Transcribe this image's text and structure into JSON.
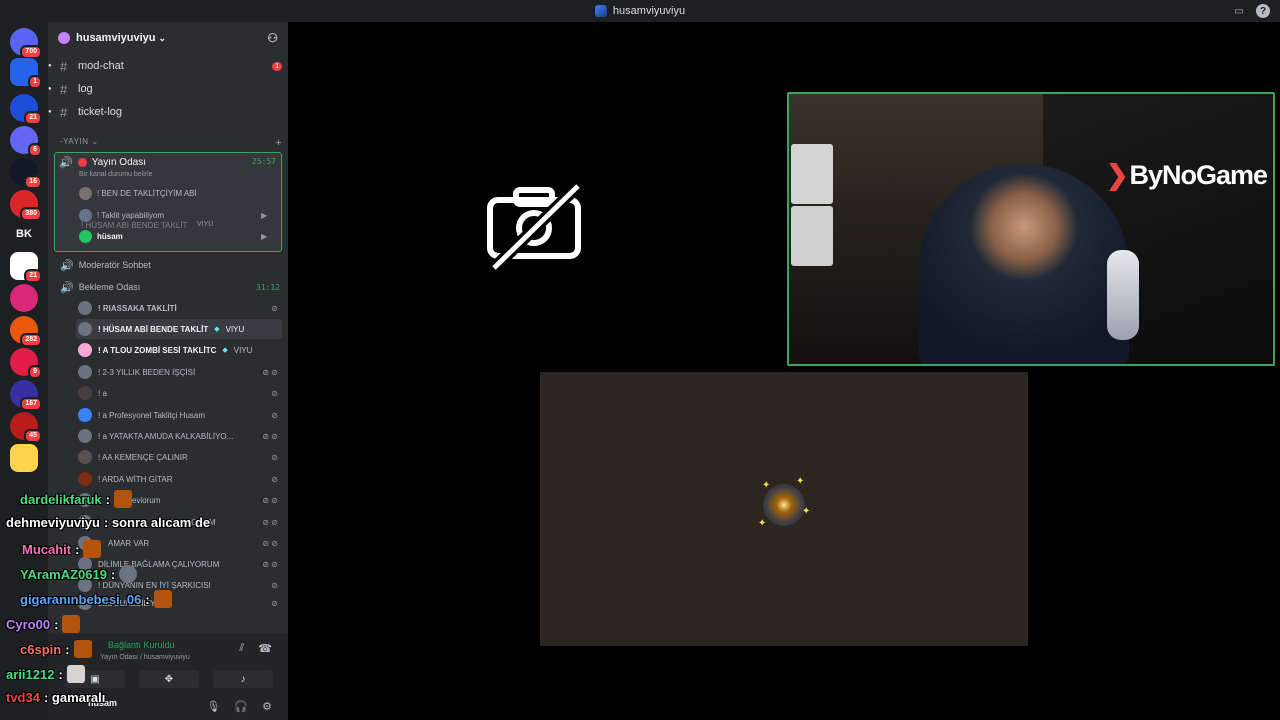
{
  "window": {
    "title": "husamviyuviyu"
  },
  "guilds": [
    {
      "id": "home",
      "badge": "700"
    },
    {
      "id": "g1",
      "badge": "1"
    },
    {
      "id": "g2",
      "badge": "21"
    },
    {
      "id": "g3",
      "badge": "6"
    },
    {
      "id": "g4",
      "badge": "16"
    },
    {
      "id": "g5",
      "badge": "380"
    },
    {
      "id": "g6",
      "text": "BK"
    },
    {
      "id": "g7",
      "badge": "21"
    },
    {
      "id": "g8",
      "badge": ""
    },
    {
      "id": "g9",
      "badge": "282"
    },
    {
      "id": "g10",
      "badge": "9"
    },
    {
      "id": "g11",
      "badge": "167"
    },
    {
      "id": "g12",
      "badge": "45"
    },
    {
      "id": "g13",
      "badge": ""
    }
  ],
  "server": {
    "name": "husamviyuviyu"
  },
  "text_channels": [
    {
      "name": "mod-chat",
      "mention": "1"
    },
    {
      "name": "log"
    },
    {
      "name": "ticket-log"
    }
  ],
  "category": {
    "name": "-YAYIN"
  },
  "active_voice": {
    "name": "Yayın Odası",
    "timer": "25:57",
    "status": "Bir kanal durumu belirle",
    "users": [
      {
        "name": "! BEN DE TAKLİTÇİYİM ABİ"
      },
      {
        "name": "! Taklit yapabiliyom"
      },
      {
        "name": "hüsam",
        "drag_text": "! HÜSAM ABİ BENDE TAKLİT",
        "tag": "VIYU"
      }
    ]
  },
  "voice_channels": [
    {
      "name": "Moderatör Sohbet"
    },
    {
      "name": "Bekleme Odası",
      "timer": "31:12"
    }
  ],
  "waiting_users": [
    {
      "name": "! RIASSAKA TAKLİTİ"
    },
    {
      "name": "! HÜSAM ABİ BENDE TAKLİT",
      "tag": "VIYU"
    },
    {
      "name": "! A TLOU ZOMBİ SESİ TAKLİTC",
      "tag": "VIYU"
    },
    {
      "name": "! 2-3 YILLIK BEDEN İŞÇİSİ"
    },
    {
      "name": "! a"
    },
    {
      "name": "! a Profesyonel Taklitçi Husam"
    },
    {
      "name": "! a YATAKTA AMUDA KALKABİLİYO..."
    },
    {
      "name": "! AA KEMENÇE ÇALINIR"
    },
    {
      "name": "! ARDA WİTH GİTAR"
    },
    {
      "name": "seviorum"
    },
    {
      "name": "ÇALIYORUM"
    },
    {
      "name": "AMAR VAR"
    },
    {
      "name": "DİLİMLE BAĞLAMA ÇALIYORUM"
    },
    {
      "name": "! DÜNYANIN EN İYİ ŞARKICISI"
    },
    {
      "name": "LEL BUKEBİLİY"
    }
  ],
  "user_panel": {
    "connection": "Bağlantı Kuruldu",
    "channel": "Yayın Odası / husamviyuviyu",
    "username": "hüsam"
  },
  "chat": [
    {
      "user": "dardelikfaruk",
      "color": "#4ade80",
      "msg": ":"
    },
    {
      "user": "dehmeviyuviyu",
      "color": "#ffffff",
      "msg": ": sonra alıcam de"
    },
    {
      "user": "Mucahit",
      "color": "#f472b6",
      "msg": ":"
    },
    {
      "user": "YAramAZ0619",
      "color": "#4ade80",
      "msg": ":"
    },
    {
      "user": "gigaranınbebesi_06",
      "color": "#60a5fa",
      "msg": ":"
    },
    {
      "user": "Cyro00",
      "color": "#c084fc",
      "msg": ":"
    },
    {
      "user": "c6spin",
      "color": "#f87171",
      "msg": ":"
    },
    {
      "user": "arii1212",
      "color": "#4ade80",
      "msg": ":"
    },
    {
      "user": "tvd34",
      "color": "#ef4444",
      "msg": ": gamaralı"
    }
  ],
  "stream": {
    "brand": "ByNoGame"
  },
  "colors": {
    "accent_green": "#3ba55c",
    "danger": "#f23f43",
    "bg_dark": "#1e1f22",
    "sidebar": "#2b2d31"
  }
}
